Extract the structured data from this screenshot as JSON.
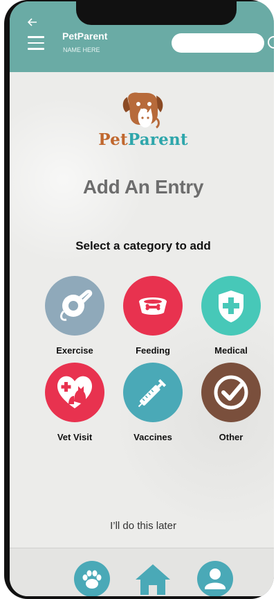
{
  "header": {
    "back_icon": "back-arrow-icon",
    "menu_icon": "hamburger-menu-icon",
    "title": "PetParent",
    "subtitle": "NAME HERE",
    "search": {
      "value": "",
      "placeholder": "",
      "icon": "search-icon"
    }
  },
  "logo": {
    "word1": "Pet",
    "word2": "Parent"
  },
  "main": {
    "title": "Add An Entry",
    "subtitle": "Select a category to add"
  },
  "categories": [
    {
      "label": "Exercise",
      "icon": "leash-icon",
      "color": "#8fa9ba"
    },
    {
      "label": "Feeding",
      "icon": "pet-bowl-icon",
      "color": "#e8324f"
    },
    {
      "label": "Medical",
      "icon": "shield-cross-icon",
      "color": "#47c8b8"
    },
    {
      "label": "Vet Visit",
      "icon": "heart-pets-icon",
      "color": "#e8324f"
    },
    {
      "label": "Vaccines",
      "icon": "syringe-icon",
      "color": "#4aa9b7"
    },
    {
      "label": "Other",
      "icon": "check-icon",
      "color": "#7a4f3c"
    }
  ],
  "footer": {
    "later_link": "I’ll do this later"
  },
  "bottom_nav": [
    {
      "icon": "paw-icon",
      "color": "#4aa9b7"
    },
    {
      "icon": "home-icon",
      "color": "#4aa9b7"
    },
    {
      "icon": "profile-icon",
      "color": "#4aa9b7"
    }
  ]
}
